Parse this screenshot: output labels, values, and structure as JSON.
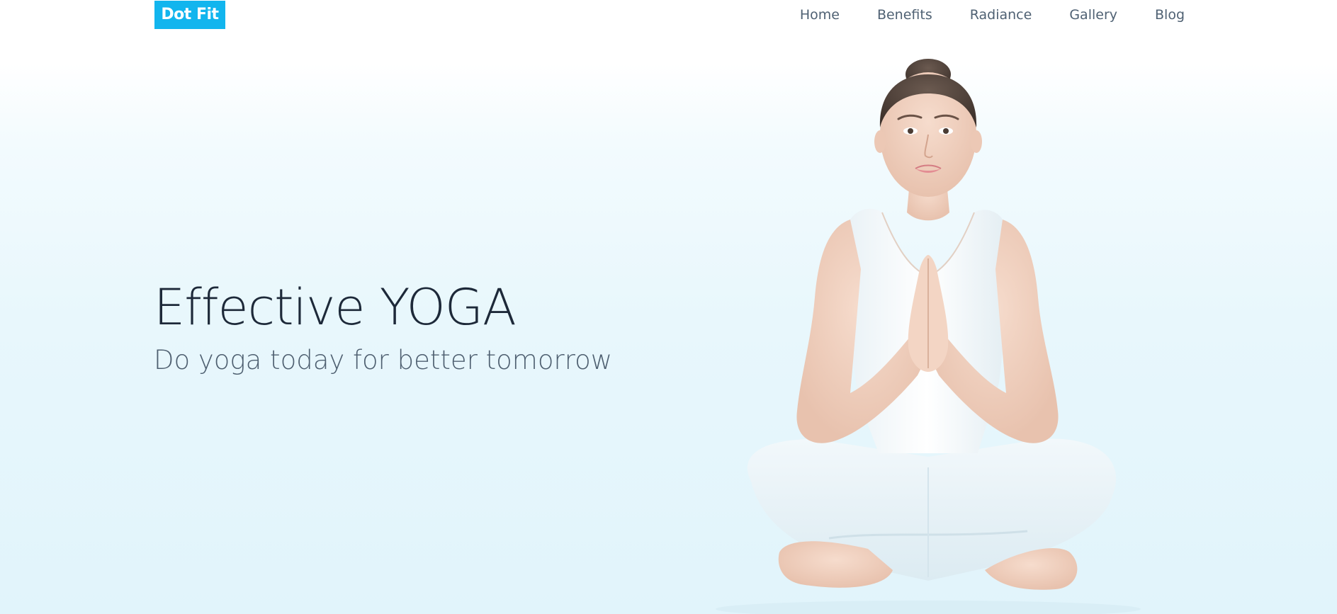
{
  "header": {
    "logo_text": "Dot Fit",
    "nav": [
      {
        "label": "Home"
      },
      {
        "label": "Benefits"
      },
      {
        "label": "Radiance"
      },
      {
        "label": "Gallery"
      },
      {
        "label": "Blog"
      }
    ]
  },
  "hero": {
    "title": "Effective YOGA",
    "subtitle": "Do yoga today for better tomorrow"
  },
  "colors": {
    "brand": "#12b5ee",
    "nav_text": "#4f6173",
    "title_text": "#1d2939",
    "subtitle_text": "#4e5f70",
    "hero_bg": "#e1f4fb"
  }
}
